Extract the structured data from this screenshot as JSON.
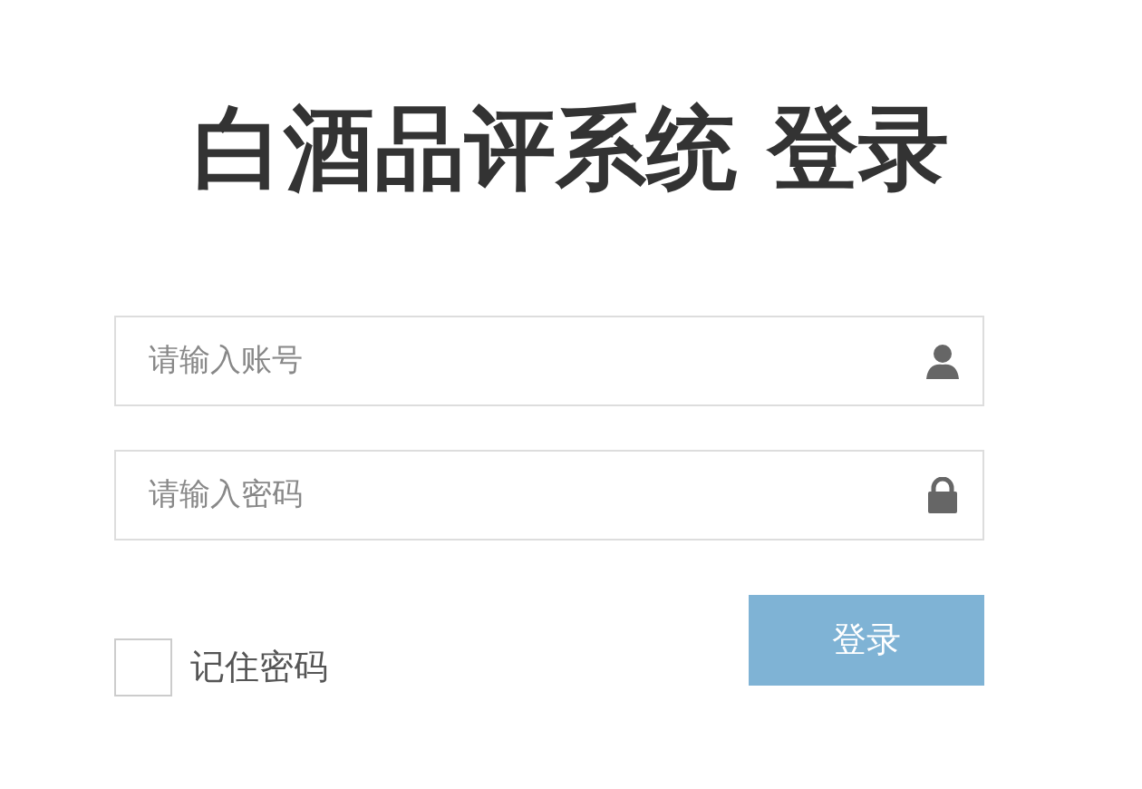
{
  "title": "白酒品评系统 登录",
  "fields": [
    {
      "kind": "user",
      "placeholder": "请输入账号"
    },
    {
      "kind": "password",
      "placeholder": "请输入密码"
    }
  ],
  "remember": {
    "label": "记住密码",
    "checked": false
  },
  "login_button": "登录"
}
